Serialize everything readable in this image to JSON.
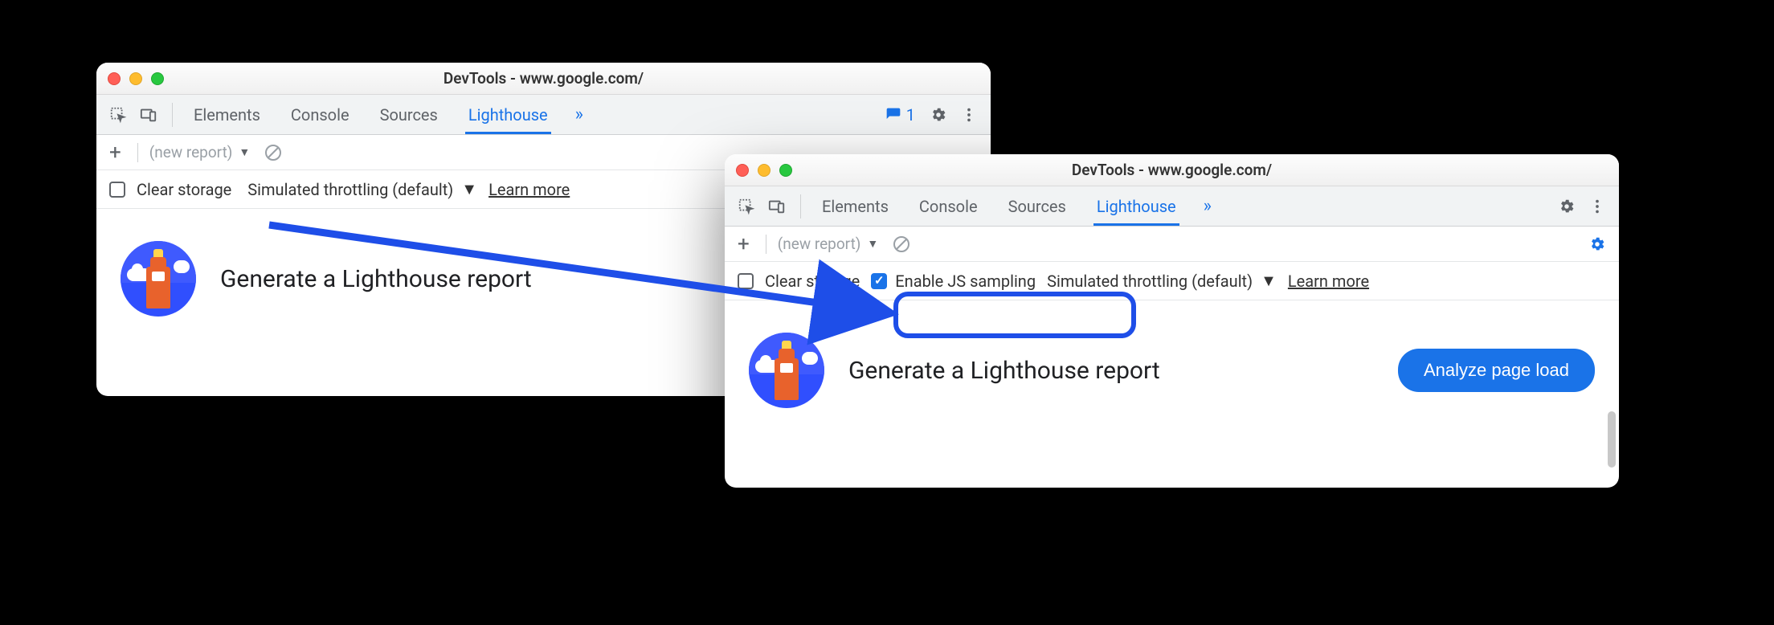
{
  "colors": {
    "accent": "#1a73e8",
    "highlight": "#1e4ee8"
  },
  "window1": {
    "title": "DevTools - www.google.com/",
    "tabs": {
      "elements": "Elements",
      "console": "Console",
      "sources": "Sources",
      "lighthouse": "Lighthouse"
    },
    "issues_count": "1",
    "report_dropdown": "(new report)",
    "options": {
      "clear_storage": "Clear storage",
      "throttling": "Simulated throttling (default)",
      "learn_more": "Learn more"
    },
    "heading": "Generate a Lighthouse report"
  },
  "window2": {
    "title": "DevTools - www.google.com/",
    "tabs": {
      "elements": "Elements",
      "console": "Console",
      "sources": "Sources",
      "lighthouse": "Lighthouse"
    },
    "report_dropdown": "(new report)",
    "options": {
      "clear_storage": "Clear storage",
      "enable_js": "Enable JS sampling",
      "throttling": "Simulated throttling (default)",
      "learn_more": "Learn more"
    },
    "heading": "Generate a Lighthouse report",
    "analyze_btn": "Analyze page load"
  }
}
